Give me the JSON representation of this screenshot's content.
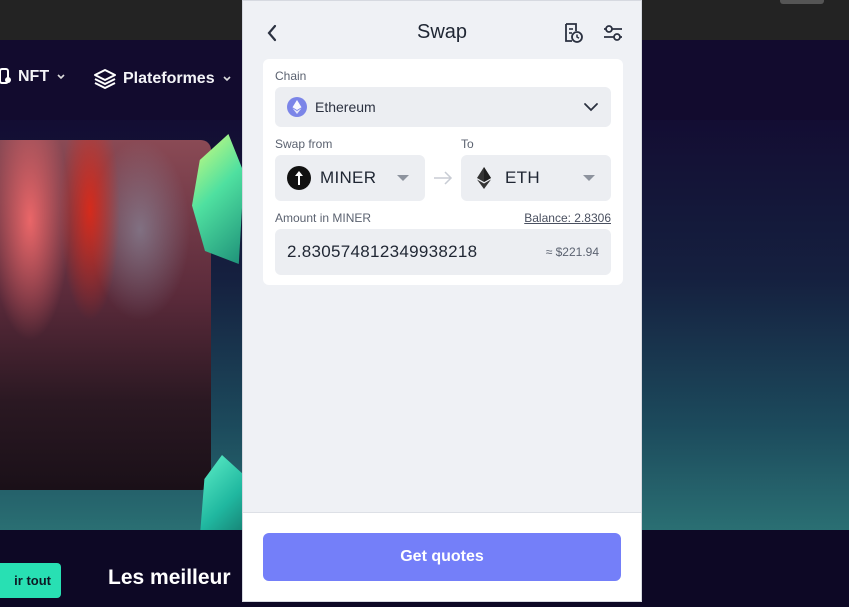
{
  "background": {
    "nav": [
      {
        "label": "NFT",
        "icon": "nft-icon"
      },
      {
        "label": "Plateformes",
        "icon": "layers-icon"
      }
    ],
    "cta_button": "ir tout",
    "heading": "Les meilleur"
  },
  "swap": {
    "title": "Swap",
    "chain": {
      "label": "Chain",
      "value": "Ethereum"
    },
    "from": {
      "label": "Swap from",
      "token": "MINER"
    },
    "to": {
      "label": "To",
      "token": "ETH"
    },
    "amount": {
      "label": "Amount in MINER",
      "balance": "Balance: 2.8306",
      "value": "2.830574812349938218",
      "usd": "≈ $221.94"
    },
    "action": "Get quotes"
  },
  "colors": {
    "accent": "#747ff9",
    "panel_bg": "#eff1f5",
    "site_bg": "#120b2e",
    "cta_green": "#28e0b3"
  }
}
